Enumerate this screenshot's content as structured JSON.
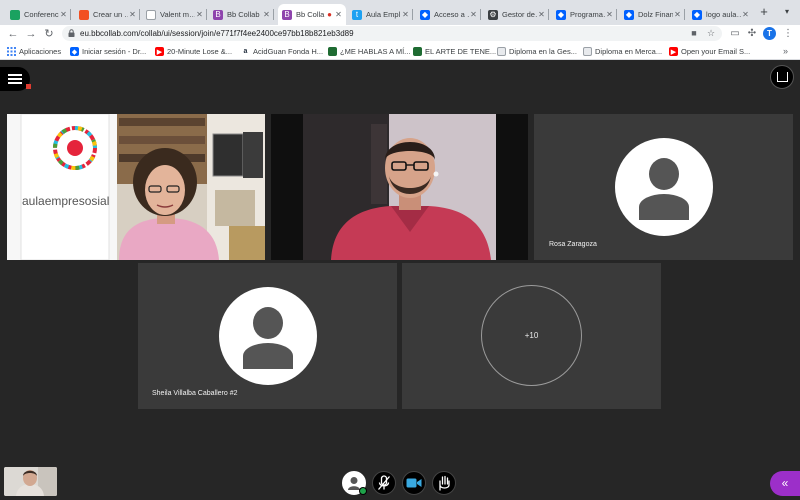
{
  "browser": {
    "tabs": [
      {
        "title": "Conferenc",
        "favicon": "green-square-icon",
        "color": "#1aa260",
        "active": false
      },
      {
        "title": "Crear un …",
        "favicon": "microsoft-icon",
        "color": "#f25022",
        "active": false
      },
      {
        "title": "Valent m…",
        "favicon": "page-icon",
        "color": "#5f6368",
        "active": false
      },
      {
        "title": "Bb Collab",
        "favicon": "collab-purple-icon",
        "color": "#8e44ad",
        "active": false
      },
      {
        "title": "Bb Colla",
        "favicon": "collab-purple-icon",
        "color": "#8e44ad",
        "active": true
      },
      {
        "title": "Aula Empl",
        "favicon": "twitter-icon",
        "color": "#1da1f2",
        "active": false
      },
      {
        "title": "Acceso a …",
        "favicon": "dropbox-icon",
        "color": "#0061ff",
        "active": false
      },
      {
        "title": "Gestor de…",
        "favicon": "gear-icon",
        "color": "#3c4043",
        "active": false
      },
      {
        "title": "Programa…",
        "favicon": "dropbox-icon",
        "color": "#0061ff",
        "active": false
      },
      {
        "title": "Dolz Finan",
        "favicon": "dropbox-icon",
        "color": "#0061ff",
        "active": false
      },
      {
        "title": "logo aula…",
        "favicon": "dropbox-icon",
        "color": "#0061ff",
        "active": false
      }
    ],
    "url": "eu.bbcollab.com/collab/ui/session/join/e771f7f4ee2400ce97bb18b821eb3d89",
    "profile_initial": "T",
    "bookmarks": [
      {
        "label": "Aplicaciones",
        "favicon": "apps-grid-icon",
        "color": "#4285f4"
      },
      {
        "label": "Iniciar sesión - Dr...",
        "favicon": "dropbox-icon",
        "color": "#0061ff"
      },
      {
        "label": "20-Minute Lose &...",
        "favicon": "youtube-icon",
        "color": "#ff0000"
      },
      {
        "label": "AcidGuan Fonda H...",
        "favicon": "amazon-icon",
        "color": "#232f3e"
      },
      {
        "label": "¿ME HABLAS A MÍ...",
        "favicon": "book-icon",
        "color": "#1e6b32"
      },
      {
        "label": "EL ARTE DE TENE...",
        "favicon": "book-icon",
        "color": "#1e6b32"
      },
      {
        "label": "Diploma en la Ges...",
        "favicon": "page-icon",
        "color": "#9aa0a6"
      },
      {
        "label": "Diploma en Merca...",
        "favicon": "page-icon",
        "color": "#9aa0a6"
      },
      {
        "label": "Open your Email S...",
        "favicon": "youtube-icon",
        "color": "#ff0000"
      }
    ]
  },
  "session": {
    "participants": [
      {
        "name": "",
        "kind": "video-woman-logo"
      },
      {
        "name": "",
        "kind": "video-man"
      },
      {
        "name": "Rosa Zaragoza",
        "kind": "avatar"
      },
      {
        "name": "Sheila Villalba Caballero #2",
        "kind": "avatar"
      }
    ],
    "overflow_count": "+10",
    "logo_text": "aulaempresosial",
    "accent_color": "#9c2fc9",
    "status_color": "#1fa34a"
  }
}
